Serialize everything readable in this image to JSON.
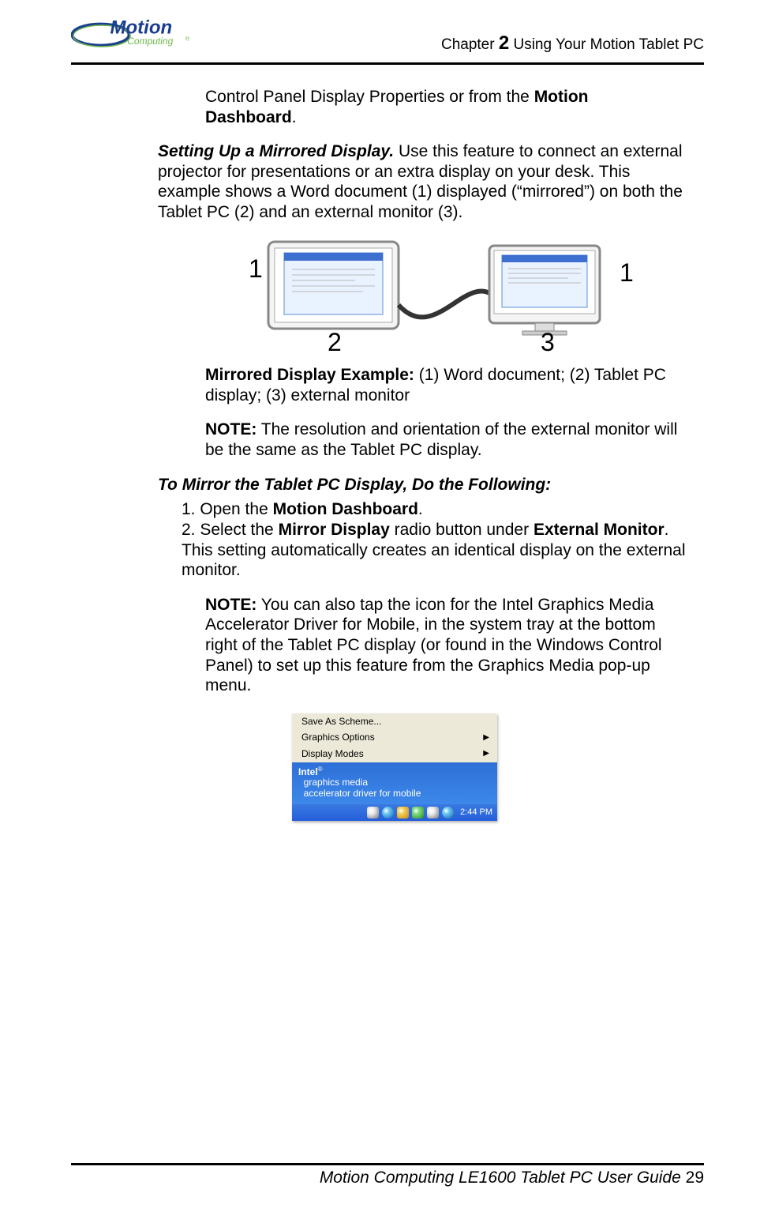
{
  "header": {
    "chapter_prefix": "Chapter ",
    "chapter_number": "2",
    "chapter_title": "  Using Your Motion Tablet PC",
    "logo": {
      "brand": "Motion",
      "sub": "Computing"
    }
  },
  "body": {
    "intro_frag_pre": "Control Panel Display Properties or from the ",
    "intro_frag_bold": "Motion Dashboard",
    "intro_frag_post": ".",
    "section1_head": "Setting Up a Mirrored Display.",
    "section1_text": " Use this feature to connect an external projector for presentations or an extra display on your desk. This example shows a Word document (1) displayed (“mirrored”) on both the Tablet PC (2) and an external monitor (3).",
    "fig1": {
      "label_left": "1",
      "label_right": "1",
      "label_2": "2",
      "label_3": "3"
    },
    "caption_bold": "Mirrored Display Example:",
    "caption_text": " (1) Word document; (2) Tablet PC display; (3) external monitor",
    "note1_bold": "NOTE:",
    "note1_text": " The resolution and orientation of the external monitor will be the same as the Tablet PC display.",
    "steps_head": "To Mirror the Tablet PC Display, Do the Following:",
    "step1_pre": "1. Open the ",
    "step1_bold": "Motion Dashboard",
    "step1_post": ".",
    "step2_pre": "2. Select the ",
    "step2_bold1": "Mirror Display",
    "step2_mid": " radio button under ",
    "step2_bold2": "External Monitor",
    "step2_post": ". This setting automatically creates an identical display on the external monitor.",
    "note2_bold": "NOTE:",
    "note2_text": " You can also tap the icon for the Intel Graphics Media Accelerator Driver for Mobile, in the system tray at the bottom right of the Tablet PC display (or found in the Windows Control Panel) to set up this feature from the Graphics Media pop-up menu.",
    "fig2": {
      "menu": [
        "Save As Scheme...",
        "Graphics Options",
        "Display Modes"
      ],
      "banner_brand": "Intel",
      "banner_line1": "graphics media",
      "banner_line2": "accelerator driver for mobile",
      "clock": "2:44 PM"
    }
  },
  "footer": {
    "text": "Motion Computing LE1600 Tablet PC User Guide ",
    "page": "29"
  }
}
